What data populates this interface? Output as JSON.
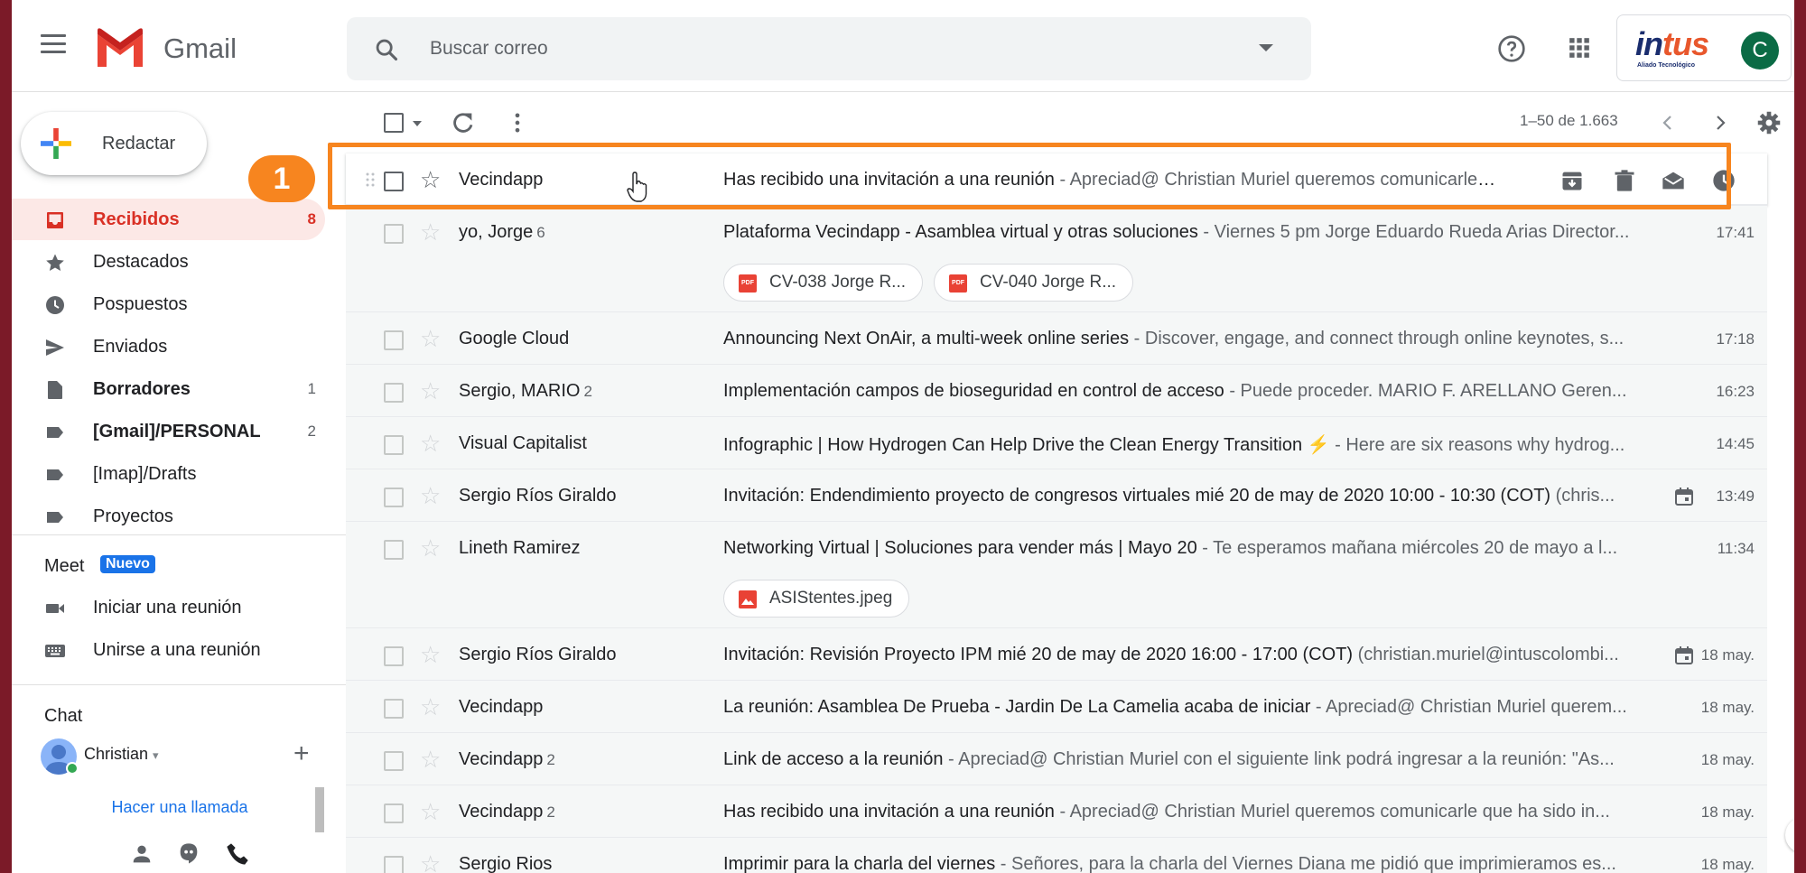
{
  "app": {
    "name": "Gmail",
    "brand_red": "#d93025",
    "accent_blue": "#1a73e8",
    "frame_color": "#7b1a28",
    "highlight_color": "#f7851f"
  },
  "header": {
    "search_placeholder": "Buscar correo",
    "help_icon": "help-icon",
    "apps_icon": "apps-grid-icon",
    "org_logo_text_a": "in",
    "org_logo_text_b": "tus",
    "org_logo_tagline": "Aliado Tecnológico",
    "avatar_letter": "C"
  },
  "sidebar": {
    "compose_label": "Redactar",
    "items": [
      {
        "label": "Recibidos",
        "count": "8",
        "icon": "inbox-icon"
      },
      {
        "label": "Destacados",
        "count": "",
        "icon": "star-icon"
      },
      {
        "label": "Pospuestos",
        "count": "",
        "icon": "clock-icon"
      },
      {
        "label": "Enviados",
        "count": "",
        "icon": "send-icon"
      },
      {
        "label": "Borradores",
        "count": "1",
        "icon": "draft-icon"
      },
      {
        "label": "[Gmail]/PERSONAL",
        "count": "2",
        "icon": "label-icon"
      },
      {
        "label": "[Imap]/Drafts",
        "count": "",
        "icon": "label-icon"
      },
      {
        "label": "Proyectos",
        "count": "",
        "icon": "label-icon"
      }
    ],
    "meet": {
      "title": "Meet",
      "badge": "Nuevo",
      "items": [
        {
          "label": "Iniciar una reunión",
          "icon": "video-camera-icon"
        },
        {
          "label": "Unirse a una reunión",
          "icon": "keyboard-icon"
        }
      ]
    },
    "chat": {
      "title": "Chat",
      "user": "Christian",
      "call_link": "Hacer una llamada"
    }
  },
  "toolbar": {
    "pagination": "1–50 de 1.663"
  },
  "annotation": {
    "step": "1"
  },
  "emails": [
    {
      "sender": "Vecindapp",
      "count": "",
      "subject": "Has recibido una invitación a una reunión",
      "snippet": " - Apreciad@ Christian Muriel queremos comunicarle que ha sido invitado...",
      "time": "",
      "attachments": [],
      "calendar": false
    },
    {
      "sender": "yo, Jorge",
      "count": "6",
      "subject": "Plataforma Vecindapp - Asamblea virtual y otras soluciones",
      "snippet": " - Viernes 5 pm Jorge Eduardo Rueda Arias Director...",
      "time": "17:41",
      "attachments": [
        {
          "name": "CV-038 Jorge R...",
          "type": "pdf"
        },
        {
          "name": "CV-040 Jorge R...",
          "type": "pdf"
        }
      ],
      "calendar": false
    },
    {
      "sender": "Google Cloud",
      "count": "",
      "subject": "Announcing Next OnAir, a multi-week online series",
      "snippet": " - Discover, engage, and connect through online keynotes, s...",
      "time": "17:18",
      "attachments": [],
      "calendar": false
    },
    {
      "sender": "Sergio, MARIO",
      "count": "2",
      "subject": "Implementación campos de bioseguridad en control de acceso",
      "snippet": " - Puede proceder. MARIO F. ARELLANO Geren...",
      "time": "16:23",
      "attachments": [],
      "calendar": false
    },
    {
      "sender": "Visual Capitalist",
      "count": "",
      "subject": "Infographic | How Hydrogen Can Help Drive the Clean Energy Transition ⚡",
      "snippet": " - Here are six reasons why hydrog...",
      "time": "14:45",
      "attachments": [],
      "calendar": false
    },
    {
      "sender": "Sergio Ríos Giraldo",
      "count": "",
      "subject": "Invitación: Endendimiento proyecto de congresos virtuales mié 20 de may de 2020 10:00 - 10:30 (COT)",
      "snippet": " (chris...",
      "time": "13:49",
      "attachments": [],
      "calendar": true
    },
    {
      "sender": "Lineth Ramirez",
      "count": "",
      "subject": "Networking Virtual | Soluciones para vender más | Mayo 20",
      "snippet": " - Te esperamos mañana miércoles 20 de mayo a l...",
      "time": "11:34",
      "attachments": [
        {
          "name": "ASIStentes.jpeg",
          "type": "img"
        }
      ],
      "calendar": false
    },
    {
      "sender": "Sergio Ríos Giraldo",
      "count": "",
      "subject": "Invitación: Revisión Proyecto IPM mié 20 de may de 2020 16:00 - 17:00 (COT)",
      "snippet": " (christian.muriel@intuscolombi...",
      "time": "18 may.",
      "attachments": [],
      "calendar": true
    },
    {
      "sender": "Vecindapp",
      "count": "",
      "subject": "La reunión: Asamblea De Prueba - Jardin De La Camelia acaba de iniciar",
      "snippet": " - Apreciad@ Christian Muriel querem...",
      "time": "18 may.",
      "attachments": [],
      "calendar": false
    },
    {
      "sender": "Vecindapp",
      "count": "2",
      "subject": "Link de acceso a la reunión",
      "snippet": " - Apreciad@ Christian Muriel con el siguiente link podrá ingresar a la reunión: \"As...",
      "time": "18 may.",
      "attachments": [],
      "calendar": false
    },
    {
      "sender": "Vecindapp",
      "count": "2",
      "subject": "Has recibido una invitación a una reunión",
      "snippet": " - Apreciad@ Christian Muriel queremos comunicarle que ha sido in...",
      "time": "18 may.",
      "attachments": [],
      "calendar": false
    },
    {
      "sender": "Sergio Rios",
      "count": "",
      "subject": "Imprimir para la charla del viernes",
      "snippet": " - Señores, para la charla del Viernes Diana me pidió que imprimieramos es...",
      "time": "18 may.",
      "attachments": [],
      "calendar": false
    }
  ]
}
